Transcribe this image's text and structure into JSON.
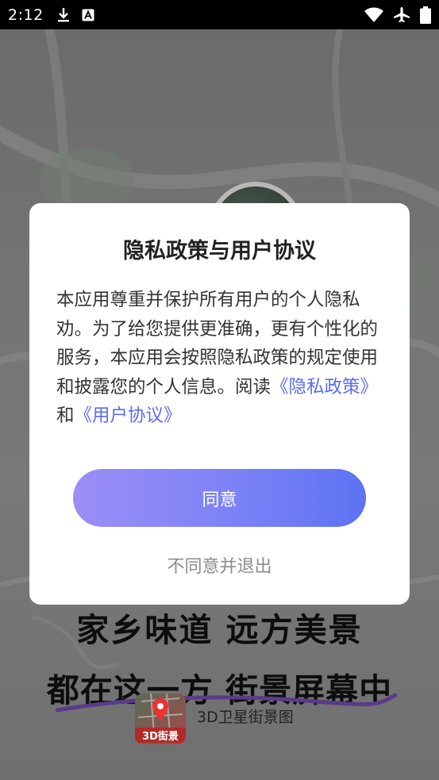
{
  "status_bar": {
    "time": "2:12",
    "icons_left": [
      "download-icon",
      "a-notification-icon"
    ],
    "icons_right": [
      "wifi-icon",
      "airplane-mode-icon",
      "battery-icon"
    ]
  },
  "background": {
    "slogan_line1": "家乡味道  远方美景",
    "slogan_line2": "都在这一方  街景屏幕中",
    "app_logo_label": "3D街景",
    "app_name": "3D卫星街景图"
  },
  "dialog": {
    "title": "隐私政策与用户协议",
    "body_text": "本应用尊重并保护所有用户的个人隐私劝。为了给您提供更准确，更有个性化的服务，本应用会按照隐私政策的规定使用和披露您的个人信息。阅读",
    "privacy_link": "《隐私政策》",
    "and_text": "和",
    "agreement_link": "《用户协议》",
    "agree_label": "同意",
    "disagree_label": "不同意并退出"
  },
  "colors": {
    "accent_start": "#9c8ef7",
    "accent_end": "#5d73f3",
    "link": "#5b6cf0"
  }
}
